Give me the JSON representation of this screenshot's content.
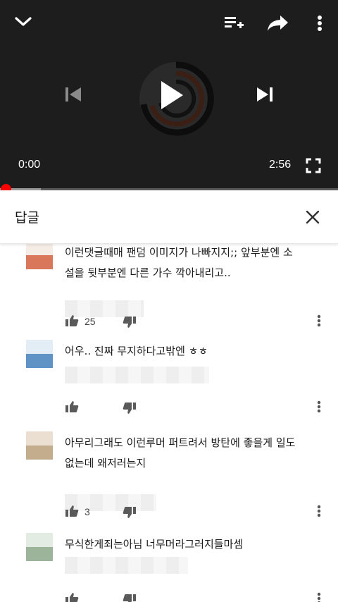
{
  "player": {
    "current_time": "0:00",
    "duration": "2:56",
    "progress": 0.0,
    "buffered": 0.12,
    "icons": [
      "chevron-down-icon",
      "add-to-queue-icon",
      "share-icon",
      "more-vert-icon",
      "previous-icon",
      "play-icon",
      "next-icon",
      "fullscreen-icon"
    ]
  },
  "replies": {
    "title": "답글",
    "close_icon": "close-icon"
  },
  "comments": [
    {
      "text_lines": [
        "이런댓글때매 팬덤 이미지가 나빠지지;; 앞부분엔 소",
        "설을 뒷부분엔 다른 가수 깍아내리고.."
      ],
      "likes": "25",
      "avatar_colors": [
        "#f6ece6",
        "#d9775a"
      ]
    },
    {
      "text_lines": [
        "어우.. 진짜 무지하다고밖엔 ㅎㅎ"
      ],
      "likes": "",
      "avatar_colors": [
        "#e3edf6",
        "#5f93c5"
      ]
    },
    {
      "text_lines": [
        "아무리그래도 이런루머 퍼트려서 방탄에 좋을게 일도",
        "없는데 왜저러는지"
      ],
      "likes": "3",
      "avatar_colors": [
        "#eadfd1",
        "#c4ad8c"
      ]
    },
    {
      "text_lines": [
        "무식한게죄는아님 너무머라그러지들마셈"
      ],
      "likes": "",
      "avatar_colors": [
        "#e2ece2",
        "#9cb59a"
      ]
    }
  ]
}
